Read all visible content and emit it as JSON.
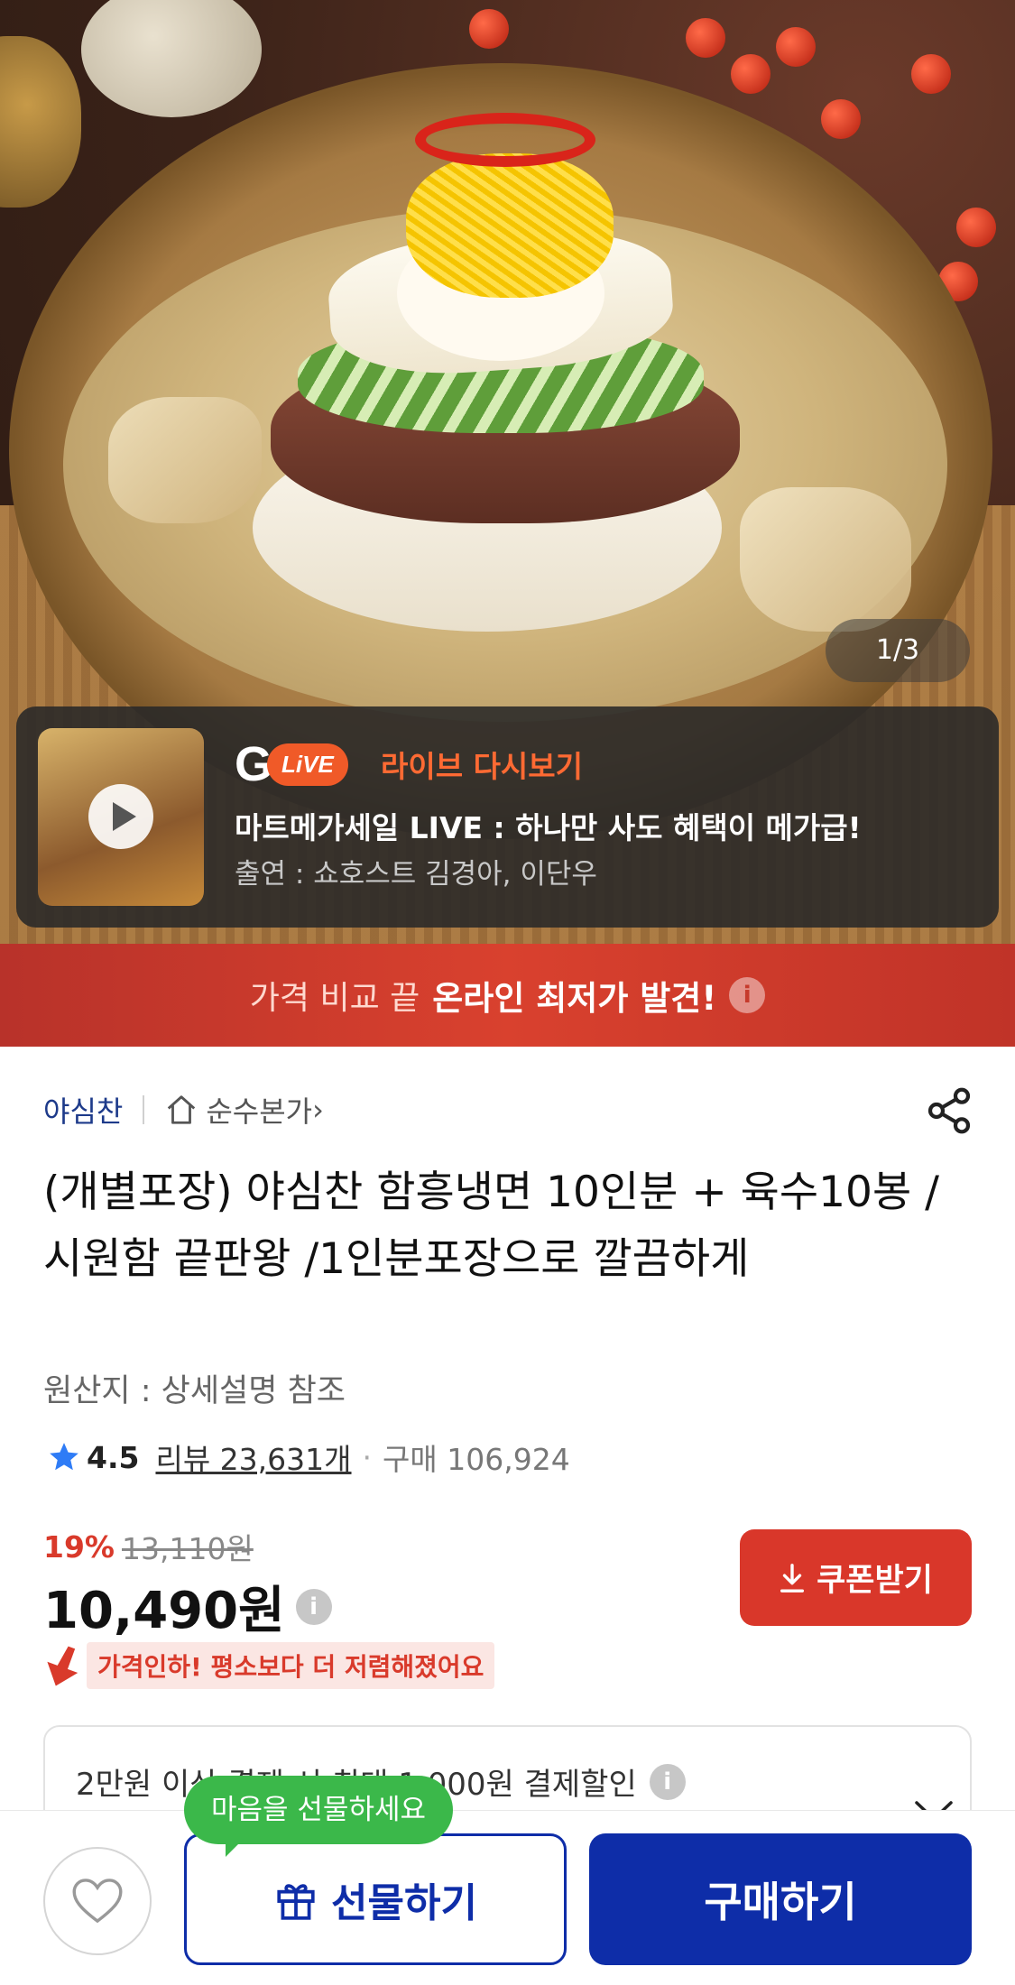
{
  "colors": {
    "brand_blue": "#0e2da8",
    "accent_red": "#d9372a",
    "live_orange": "#f05a28",
    "gift_tooltip_green": "#3bb84a"
  },
  "hero": {
    "image_counter": "1/3"
  },
  "live_banner": {
    "logo_g": "G",
    "logo_badge": "LiVE",
    "replay_label": "라이브 다시보기",
    "title": "마트메가세일 LIVE : 하나만 사도 혜택이 메가급!",
    "cast": "출연 : 쇼호스트 김경아, 이단우",
    "thumbnail_icon": "play-icon"
  },
  "price_band": {
    "prefix": "가격 비교 끝",
    "highlight": "온라인 최저가 발견!",
    "info_icon": "i"
  },
  "product": {
    "brand": "야심찬",
    "store": "순수본가",
    "store_chevron": "›",
    "title": "(개별포장) 야심찬 함흥냉면 10인분  + 육수10봉 /시원함 끝판왕 /1인분포장으로 깔끔하게",
    "origin": "원산지 : 상세설명 참조",
    "rating": "4.5",
    "reviews": "리뷰 23,631개",
    "separator": "·",
    "sold": "구매 106,924",
    "discount": "19%",
    "original_price": "13,110원",
    "price": "10,490원",
    "price_info_icon": "i",
    "price_drop": "가격인하! 평소보다 더 저렴해졌어요",
    "coupon_label": "쿠폰받기",
    "payment_discount": "2만원 이상 결제 시 최대 1,000원 결제할인",
    "payment_info_icon": "i"
  },
  "bottom_bar": {
    "gift_tooltip": "마음을 선물하세요",
    "gift_label": "선물하기",
    "buy_label": "구매하기"
  }
}
